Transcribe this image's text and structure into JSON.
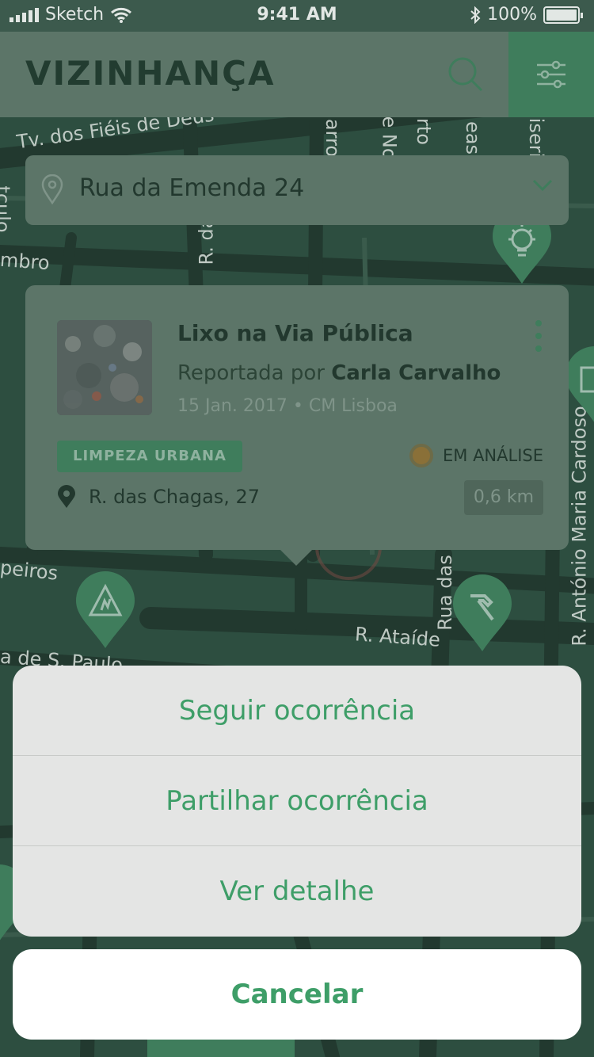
{
  "status_bar": {
    "carrier": "Sketch",
    "time": "9:41 AM",
    "battery": "100%"
  },
  "header": {
    "title": "VIZINHANÇA"
  },
  "address": {
    "value": "Rua da Emenda 24"
  },
  "map": {
    "streets": [
      "Tv. dos Fiéis de Deus",
      "R. da",
      "R. Ataíde",
      "Rua das Fl",
      "R. António Maria Cardoso",
      "peiros",
      "a de S. Paulo",
      "mbro",
      "rto",
      "arro",
      "e No",
      "eas",
      "iseri",
      "tculo"
    ]
  },
  "card": {
    "title": "Lixo na Via Pública",
    "reported_prefix": "Reportada por",
    "reporter": "Carla Carvalho",
    "meta": "15 Jan. 2017 • CM Lisboa",
    "category": "LIMPEZA URBANA",
    "status": "EM ANÁLISE",
    "location": "R. das Chagas, 27",
    "distance": "0,6 km"
  },
  "sheet": {
    "actions": [
      "Seguir ocorrência",
      "Partilhar ocorrência",
      "Ver detalhe"
    ],
    "cancel": "Cancelar"
  },
  "colors": {
    "accent": "#3e9e68",
    "header_bg": "#5c7568",
    "filter_bg": "#3f7d5c"
  },
  "icons": [
    "location-pin-icon",
    "search-icon",
    "filter-sliders-icon",
    "chevron-down-icon",
    "more-vertical-icon",
    "lightbulb-icon",
    "traffic-sign-icon",
    "hammer-icon",
    "trash-icon"
  ]
}
